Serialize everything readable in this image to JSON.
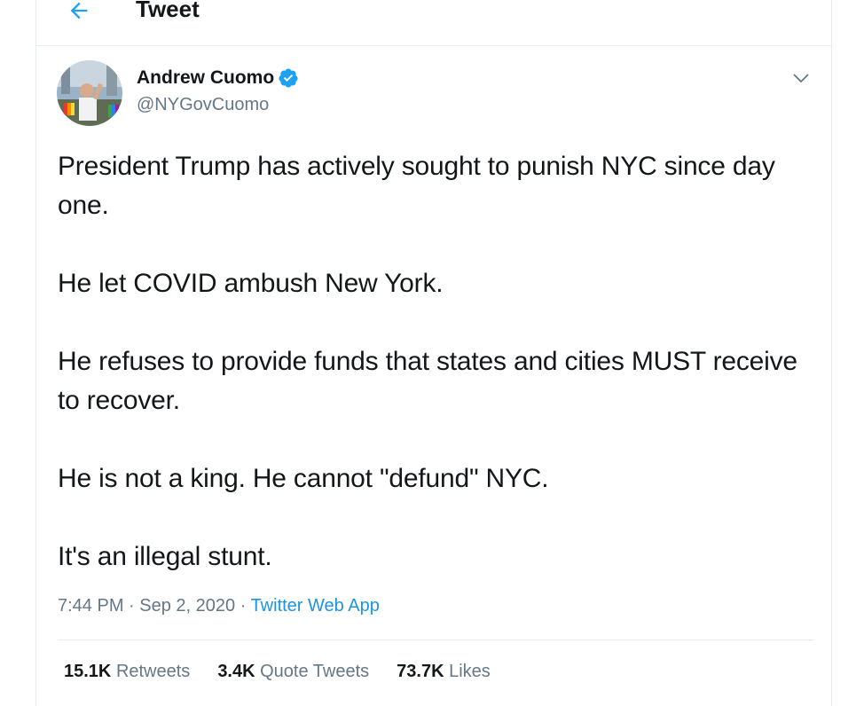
{
  "header": {
    "title": "Tweet"
  },
  "author": {
    "name": "Andrew Cuomo",
    "handle": "@NYGovCuomo",
    "verified": true
  },
  "tweet": {
    "paragraphs": [
      "President Trump has actively sought to punish NYC since day one.",
      "He let COVID ambush New York.",
      "He refuses to provide funds that states and cities MUST receive to recover.",
      "He is not a king. He cannot \"defund\" NYC.",
      "It's an illegal stunt."
    ],
    "time": "7:44 PM",
    "separator": " · ",
    "date": "Sep 2, 2020",
    "source": "Twitter Web App"
  },
  "stats": {
    "retweets_count": "15.1K",
    "retweets_label": "Retweets",
    "quotes_count": "3.4K",
    "quotes_label": "Quote Tweets",
    "likes_count": "73.7K",
    "likes_label": "Likes"
  },
  "colors": {
    "accent": "#1da1f2",
    "link": "#1b95e0",
    "muted": "#657786",
    "divider": "#e6ecf0"
  },
  "icons": [
    "back-arrow-icon",
    "verified-badge-icon",
    "chevron-down-icon"
  ]
}
